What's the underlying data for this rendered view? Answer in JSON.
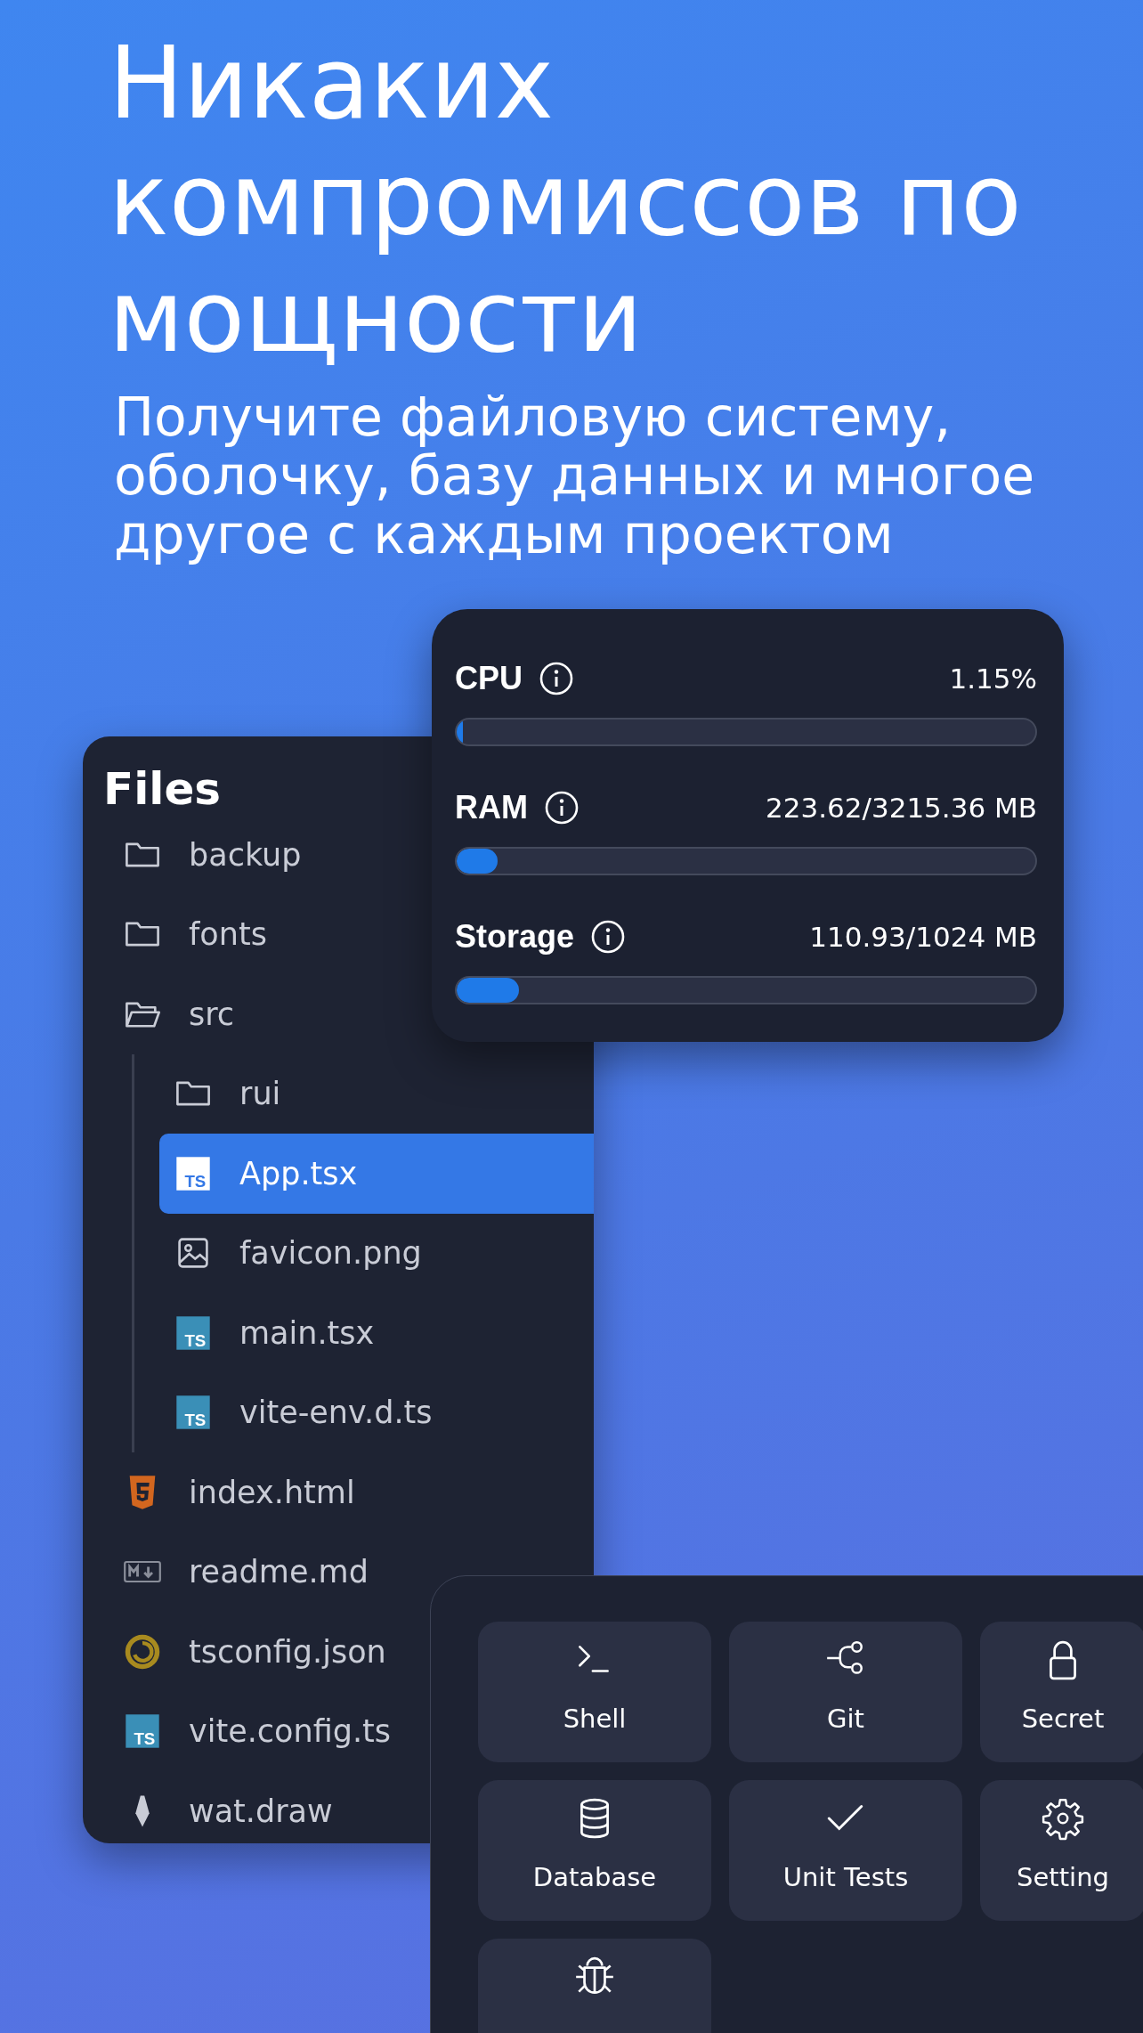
{
  "headline": "Никаких компромиссов по мощности",
  "subtitle": "Получите файловую систему, оболочку, базу данных и многое другое с каждым проектом",
  "resources": [
    {
      "name": "CPU",
      "value": "1.15%",
      "level": 0.0115
    },
    {
      "name": "RAM",
      "value": "223.62/3215.36 MB",
      "level": 0.07
    },
    {
      "name": "Storage",
      "value": "110.93/1024 MB",
      "level": 0.108
    }
  ],
  "files": {
    "title": "Files",
    "items": [
      {
        "name": "backup",
        "kind": "folder",
        "expanded": false,
        "selected": false
      },
      {
        "name": "fonts",
        "kind": "folder",
        "expanded": false,
        "selected": false
      },
      {
        "name": "src",
        "kind": "folder",
        "expanded": true,
        "selected": false,
        "children": [
          {
            "name": "rui",
            "kind": "folder",
            "expanded": false,
            "selected": false
          },
          {
            "name": "App.tsx",
            "kind": "ts",
            "icon_text": "TS",
            "selected": true
          },
          {
            "name": "favicon.png",
            "kind": "image",
            "selected": false
          },
          {
            "name": "main.tsx",
            "kind": "ts",
            "icon_text": "TS",
            "selected": false
          },
          {
            "name": "vite-env.d.ts",
            "kind": "ts",
            "icon_text": "TS",
            "selected": false
          }
        ]
      },
      {
        "name": "index.html",
        "kind": "html",
        "selected": false
      },
      {
        "name": "readme.md",
        "kind": "markdown",
        "selected": false
      },
      {
        "name": "tsconfig.json",
        "kind": "tsconfig",
        "selected": false
      },
      {
        "name": "vite.config.ts",
        "kind": "ts",
        "icon_text": "TS",
        "selected": false
      },
      {
        "name": "wat.draw",
        "kind": "drawing",
        "selected": false
      }
    ]
  },
  "tools": [
    {
      "label": "Shell",
      "kind": "shell"
    },
    {
      "label": "Git",
      "kind": "git"
    },
    {
      "label": "Secret",
      "kind": "lock"
    },
    {
      "label": "Database",
      "kind": "database"
    },
    {
      "label": "Unit Tests",
      "kind": "check"
    },
    {
      "label": "Setting",
      "kind": "gear"
    },
    {
      "kind": "bug"
    }
  ]
}
